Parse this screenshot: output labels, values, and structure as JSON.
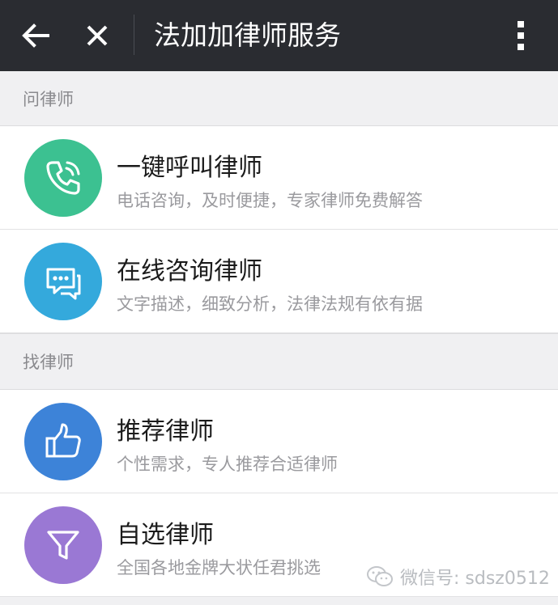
{
  "header": {
    "title": "法加加律师服务",
    "background": "#2a2c31"
  },
  "sections": [
    {
      "label": "问律师",
      "items": [
        {
          "title": "一键呼叫律师",
          "subtitle": "电话咨询，及时便捷，专家律师免费解答",
          "icon": "phone-icon",
          "color": "#3cc191"
        },
        {
          "title": "在线咨询律师",
          "subtitle": "文字描述，细致分析，法律法规有依有据",
          "icon": "chat-bubble-icon",
          "color": "#34a9dc"
        }
      ]
    },
    {
      "label": "找律师",
      "items": [
        {
          "title": "推荐律师",
          "subtitle": "个性需求，专人推荐合适律师",
          "icon": "thumbs-up-icon",
          "color": "#3d83d8"
        },
        {
          "title": "自选律师",
          "subtitle": "全国各地金牌大状任君挑选",
          "icon": "filter-icon",
          "color": "#9a78d4"
        }
      ]
    }
  ],
  "watermark": {
    "text": "微信号: sdsz0512"
  }
}
